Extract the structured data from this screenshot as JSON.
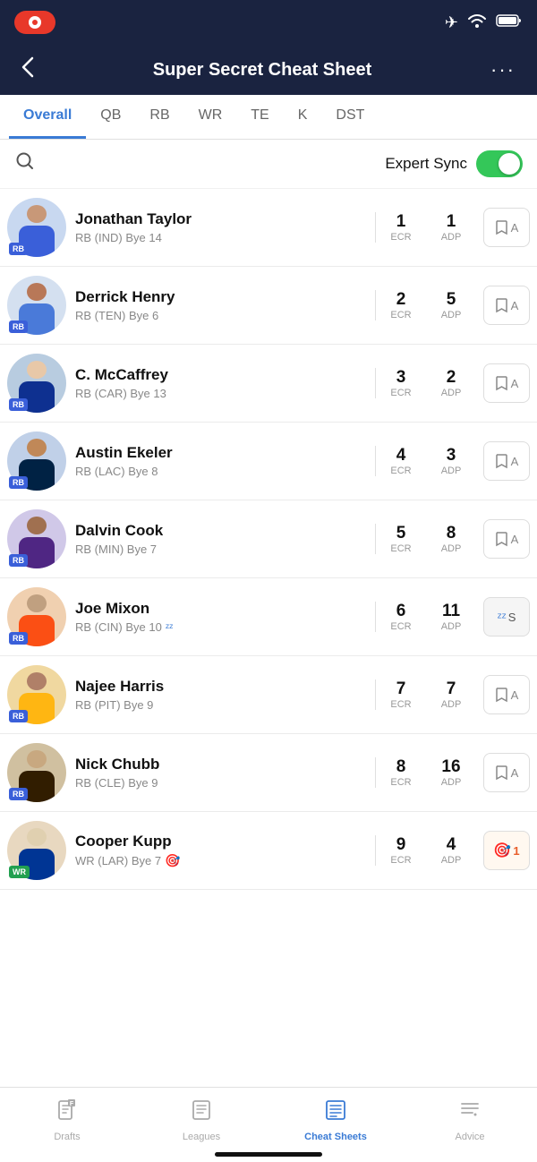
{
  "statusBar": {
    "recordLabel": "",
    "planeIcon": "✈",
    "wifiIcon": "wifi",
    "batteryIcon": "battery"
  },
  "header": {
    "backLabel": "‹",
    "title": "Super Secret Cheat Sheet",
    "moreLabel": "···"
  },
  "tabs": [
    {
      "id": "overall",
      "label": "Overall",
      "active": true
    },
    {
      "id": "qb",
      "label": "QB",
      "active": false
    },
    {
      "id": "rb",
      "label": "RB",
      "active": false
    },
    {
      "id": "wr",
      "label": "WR",
      "active": false
    },
    {
      "id": "te",
      "label": "TE",
      "active": false
    },
    {
      "id": "k",
      "label": "K",
      "active": false
    },
    {
      "id": "dst",
      "label": "DST",
      "active": false
    }
  ],
  "searchPlaceholder": "Search",
  "expertSync": {
    "label": "Expert Sync",
    "enabled": true
  },
  "players": [
    {
      "name": "Jonathan Taylor",
      "details": "RB (IND) Bye 14",
      "position": "RB",
      "ecr": "1",
      "adp": "1",
      "actionType": "tag",
      "actionLabel": "A",
      "sleepFlag": false,
      "targetFlag": false,
      "faceClass": "face-1",
      "jerseyClass": "jersey-1"
    },
    {
      "name": "Derrick Henry",
      "details": "RB (TEN) Bye 6",
      "position": "RB",
      "ecr": "2",
      "adp": "5",
      "actionType": "tag",
      "actionLabel": "A",
      "sleepFlag": false,
      "targetFlag": false,
      "faceClass": "face-2",
      "jerseyClass": "jersey-2"
    },
    {
      "name": "C. McCaffrey",
      "details": "RB (CAR) Bye 13",
      "position": "RB",
      "ecr": "3",
      "adp": "2",
      "actionType": "tag",
      "actionLabel": "A",
      "sleepFlag": false,
      "targetFlag": false,
      "faceClass": "face-3",
      "jerseyClass": "jersey-3"
    },
    {
      "name": "Austin Ekeler",
      "details": "RB (LAC) Bye 8",
      "position": "RB",
      "ecr": "4",
      "adp": "3",
      "actionType": "tag",
      "actionLabel": "A",
      "sleepFlag": false,
      "targetFlag": false,
      "faceClass": "face-4",
      "jerseyClass": "jersey-4"
    },
    {
      "name": "Dalvin Cook",
      "details": "RB (MIN) Bye 7",
      "position": "RB",
      "ecr": "5",
      "adp": "8",
      "actionType": "tag",
      "actionLabel": "A",
      "sleepFlag": false,
      "targetFlag": false,
      "faceClass": "face-5",
      "jerseyClass": "jersey-5"
    },
    {
      "name": "Joe Mixon",
      "details": "RB (CIN) Bye 10",
      "position": "RB",
      "ecr": "6",
      "adp": "11",
      "actionType": "snooze",
      "actionLabel": "S",
      "sleepFlag": true,
      "targetFlag": false,
      "faceClass": "face-6",
      "jerseyClass": "jersey-6"
    },
    {
      "name": "Najee Harris",
      "details": "RB (PIT) Bye 9",
      "position": "RB",
      "ecr": "7",
      "adp": "7",
      "actionType": "tag",
      "actionLabel": "A",
      "sleepFlag": false,
      "targetFlag": false,
      "faceClass": "face-7",
      "jerseyClass": "jersey-7"
    },
    {
      "name": "Nick Chubb",
      "details": "RB (CLE) Bye 9",
      "position": "RB",
      "ecr": "8",
      "adp": "16",
      "actionType": "tag",
      "actionLabel": "A",
      "sleepFlag": false,
      "targetFlag": false,
      "faceClass": "face-8",
      "jerseyClass": "jersey-8"
    },
    {
      "name": "Cooper Kupp",
      "details": "WR (LAR) Bye 7",
      "position": "WR",
      "ecr": "9",
      "adp": "4",
      "actionType": "target",
      "actionLabel": "1",
      "sleepFlag": false,
      "targetFlag": true,
      "faceClass": "face-9",
      "jerseyClass": "jersey-9"
    }
  ],
  "bottomNav": [
    {
      "id": "drafts",
      "label": "Drafts",
      "icon": "drafts",
      "active": false
    },
    {
      "id": "leagues",
      "label": "Leagues",
      "icon": "leagues",
      "active": false
    },
    {
      "id": "cheatsheets",
      "label": "Cheat Sheets",
      "icon": "cheatsheets",
      "active": true
    },
    {
      "id": "advice",
      "label": "Advice",
      "icon": "advice",
      "active": false
    }
  ]
}
